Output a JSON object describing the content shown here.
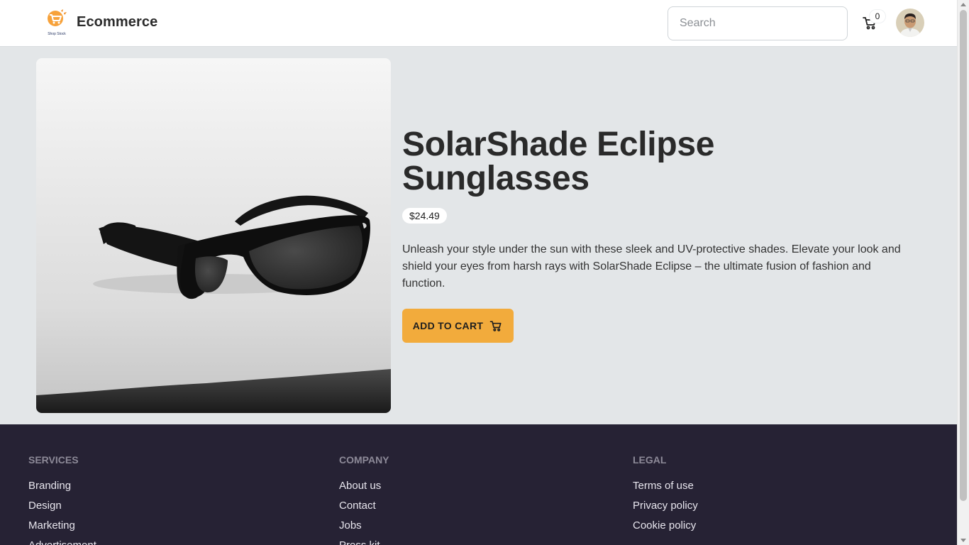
{
  "header": {
    "logo_text": "Shop Stock",
    "brand": "Ecommerce",
    "search_placeholder": "Search",
    "cart_count": "0"
  },
  "product": {
    "title": "SolarShade Eclipse Sunglasses",
    "price": "$24.49",
    "description": "Unleash your style under the sun with these sleek and UV-protective shades. Elevate your look and shield your eyes from harsh rays with SolarShade Eclipse – the ultimate fusion of fashion and function.",
    "add_to_cart_label": "ADD TO CART"
  },
  "footer": {
    "services": {
      "heading": "SERVICES",
      "links": [
        "Branding",
        "Design",
        "Marketing",
        "Advertisement"
      ]
    },
    "company": {
      "heading": "COMPANY",
      "links": [
        "About us",
        "Contact",
        "Jobs",
        "Press kit"
      ]
    },
    "legal": {
      "heading": "LEGAL",
      "links": [
        "Terms of use",
        "Privacy policy",
        "Cookie policy"
      ]
    }
  },
  "colors": {
    "accent": "#f2ab3c",
    "page_bg": "#e3e6e8",
    "footer_bg": "#262234"
  },
  "icons": {
    "logo": "shop-stock-logo",
    "cart": "cart-icon",
    "avatar": "user-avatar"
  }
}
